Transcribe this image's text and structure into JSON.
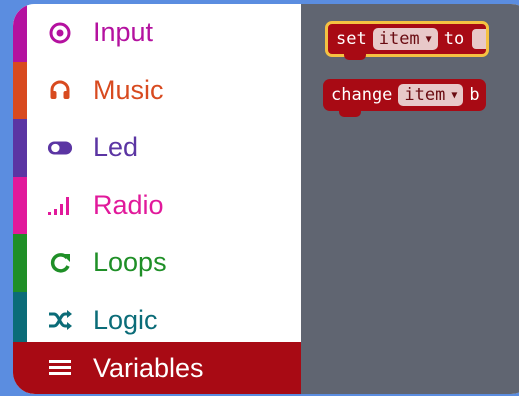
{
  "toolbox": {
    "categories": [
      {
        "name": "input",
        "label": "Input",
        "color": "#b4119f",
        "icon": "target-icon"
      },
      {
        "name": "music",
        "label": "Music",
        "color": "#d84a1f",
        "icon": "headphones-icon"
      },
      {
        "name": "led",
        "label": "Led",
        "color": "#5b35a3",
        "icon": "toggle-icon"
      },
      {
        "name": "radio",
        "label": "Radio",
        "color": "#e1199b",
        "icon": "signal-bars-icon"
      },
      {
        "name": "loops",
        "label": "Loops",
        "color": "#1f8f27",
        "icon": "refresh-icon"
      },
      {
        "name": "logic",
        "label": "Logic",
        "color": "#0b6c78",
        "icon": "shuffle-icon"
      },
      {
        "name": "variables",
        "label": "Variables",
        "color": "#a80a14",
        "icon": "list-icon",
        "selected": true
      }
    ]
  },
  "workspace": {
    "blocks": [
      {
        "name": "set-block",
        "keyword": "set",
        "variable": "item",
        "suffix": "to"
      },
      {
        "name": "change-block",
        "keyword": "change",
        "variable": "item",
        "suffix": "b"
      }
    ]
  },
  "colors": {
    "page_background": "#5b8de0",
    "workspace_background": "#606571",
    "variables_block": "#a80a14",
    "highlight_outline": "#f5c242"
  }
}
